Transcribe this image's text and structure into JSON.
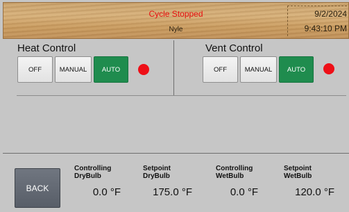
{
  "header": {
    "status": "Cycle Stopped",
    "brand": "Nyle",
    "date": "9/2/2024",
    "time": "9:43:10 PM"
  },
  "colors": {
    "status_text": "#e81010",
    "active_button": "#1f8c4e",
    "indicator_led": "#ee0f17",
    "back_button": "#626872"
  },
  "heat_control": {
    "title": "Heat Control",
    "buttons": [
      "OFF",
      "MANUAL",
      "AUTO"
    ],
    "active_mode": "AUTO",
    "indicator": "red"
  },
  "vent_control": {
    "title": "Vent Control",
    "buttons": [
      "OFF",
      "MANUAL",
      "AUTO"
    ],
    "active_mode": "AUTO",
    "indicator": "red"
  },
  "readouts": {
    "back_label": "BACK",
    "controlling_drybulb": {
      "label_line1": "Controlling",
      "label_line2": "DryBulb",
      "value": "0.0 °F"
    },
    "setpoint_drybulb": {
      "label_line1": "Setpoint",
      "label_line2": "DryBulb",
      "value": "175.0 °F"
    },
    "controlling_wetbulb": {
      "label_line1": "Controlling",
      "label_line2": "WetBulb",
      "value": "0.0 °F"
    },
    "setpoint_wetbulb": {
      "label_line1": "Setpoint",
      "label_line2": "WetBulb",
      "value": "120.0 °F"
    }
  }
}
